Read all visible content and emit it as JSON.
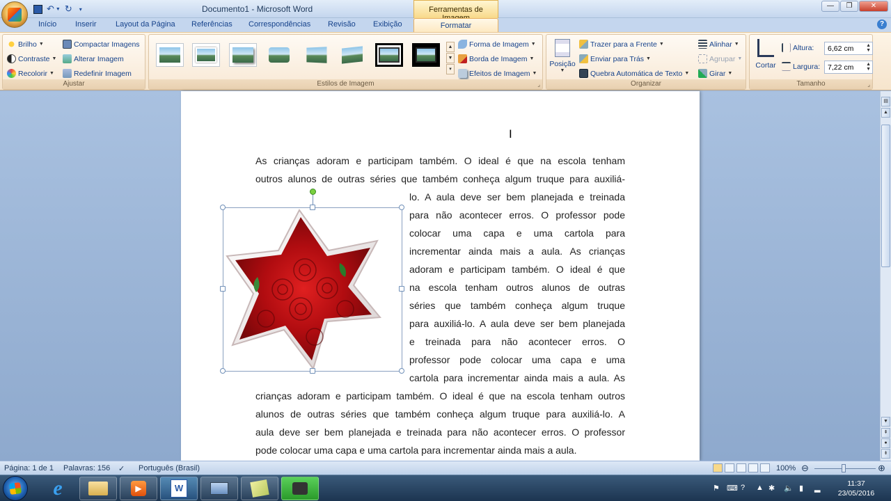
{
  "window": {
    "doc_title": "Documento1 - Microsoft Word",
    "context_tab_title": "Ferramentas de Imagem"
  },
  "tabs": [
    "Início",
    "Inserir",
    "Layout da Página",
    "Referências",
    "Correspondências",
    "Revisão",
    "Exibição"
  ],
  "active_tab": "Formatar",
  "ribbon": {
    "ajustar": {
      "label": "Ajustar",
      "brilho": "Brilho",
      "contraste": "Contraste",
      "recolorir": "Recolorir",
      "compactar": "Compactar Imagens",
      "alterar": "Alterar Imagem",
      "redefinir": "Redefinir Imagem"
    },
    "estilos": {
      "label": "Estilos de Imagem",
      "forma": "Forma de Imagem",
      "borda": "Borda de Imagem",
      "efeitos": "Efeitos de Imagem"
    },
    "organizar": {
      "label": "Organizar",
      "posicao": "Posição",
      "trazer": "Trazer para a Frente",
      "enviar": "Enviar para Trás",
      "quebra": "Quebra Automática de Texto",
      "alinhar": "Alinhar",
      "agrupar": "Agrupar",
      "girar": "Girar"
    },
    "tamanho": {
      "label": "Tamanho",
      "cortar": "Cortar",
      "altura_label": "Altura:",
      "altura_value": "6,62 cm",
      "largura_label": "Largura:",
      "largura_value": "7,22 cm"
    }
  },
  "document": {
    "lines_full_top": [
      "As crianças adoram e participam também. O ideal é que na escola tenham",
      "outros alunos de outras séries que também conheça algum truque para auxiliá-"
    ],
    "lines_wrapped": [
      "lo. A aula deve ser bem planejada e treinada",
      "para não acontecer erros. O professor pode",
      "colocar uma capa e uma cartola para",
      "incrementar ainda mais a aula. As crianças",
      "adoram e participam também. O ideal é que",
      "na escola tenham outros alunos de outras",
      "séries que também conheça algum truque",
      "para auxiliá-lo. A aula deve ser bem planejada",
      "e treinada para não acontecer erros. O",
      "professor pode colocar uma capa e uma",
      "cartola para incrementar ainda mais a aula. As"
    ],
    "lines_full_bottom": [
      "crianças adoram e participam também. O ideal é que na escola tenham outros",
      "alunos de outras séries que também conheça algum truque para auxiliá-lo. A",
      "aula deve ser bem planejada e treinada para não acontecer erros. O professor",
      "pode colocar uma capa e uma cartola para incrementar ainda mais a aula."
    ]
  },
  "status": {
    "pagina": "Página: 1 de 1",
    "palavras": "Palavras: 156",
    "idioma": "Português (Brasil)",
    "zoom": "100%"
  },
  "taskbar": {
    "time": "11:37",
    "date": "23/05/2016"
  },
  "colors": {
    "ribbon_bg": "#fdf4e6",
    "context_tab": "#f8d98a",
    "accent": "#15428b"
  }
}
